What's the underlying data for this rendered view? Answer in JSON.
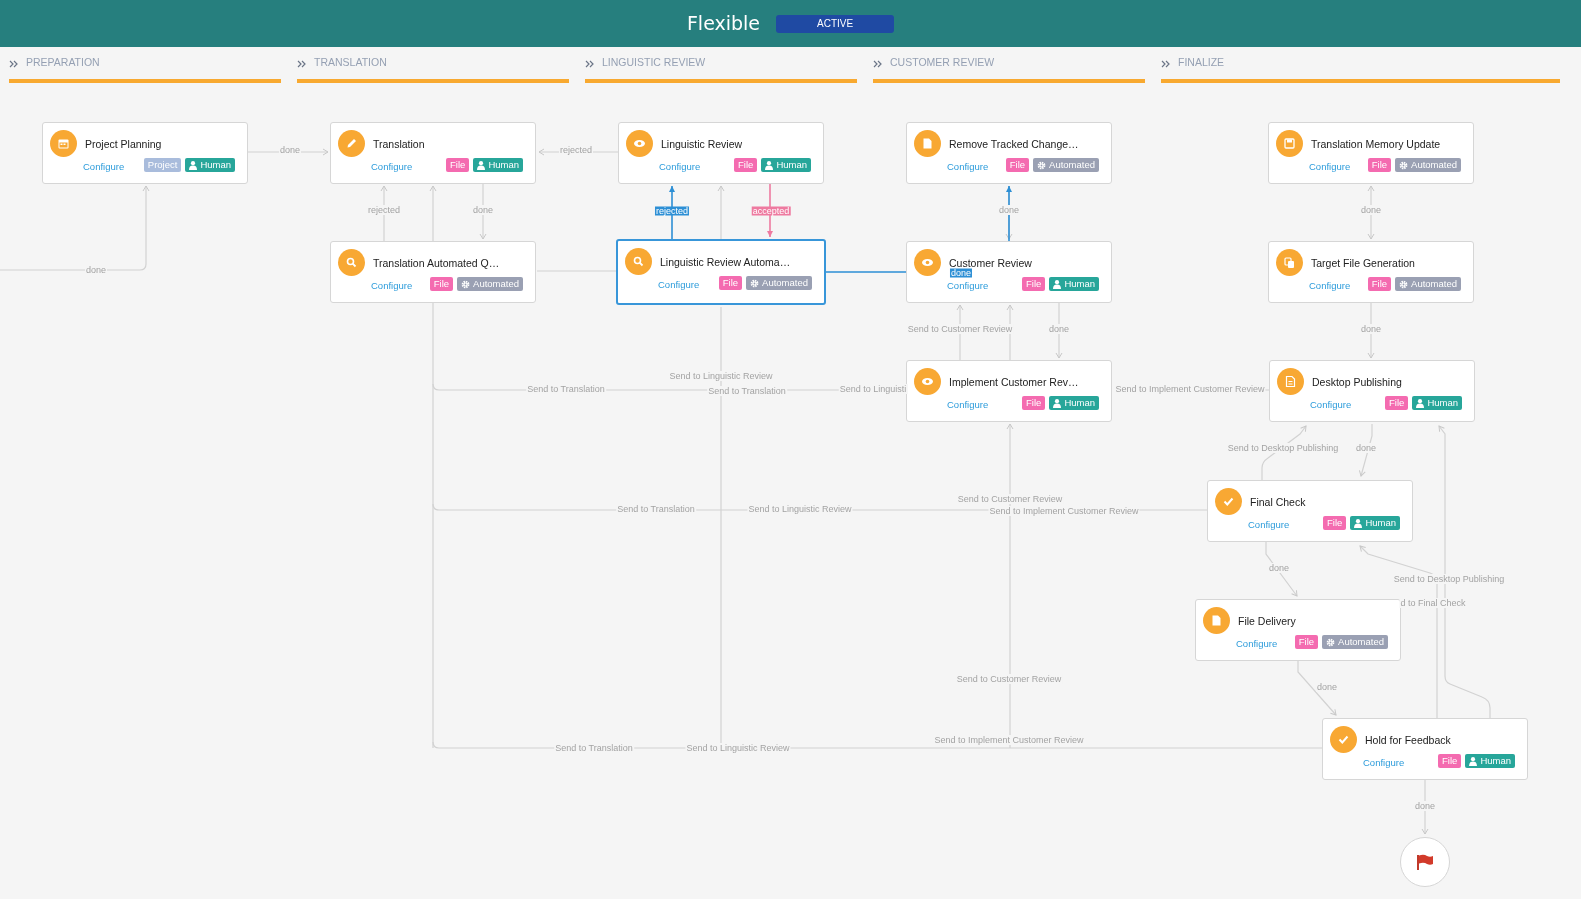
{
  "header": {
    "title": "Flexible",
    "status": "ACTIVE"
  },
  "stages": [
    {
      "label": "PREPARATION"
    },
    {
      "label": "TRANSLATION"
    },
    {
      "label": "LINGUISTIC REVIEW"
    },
    {
      "label": "CUSTOMER REVIEW"
    },
    {
      "label": "FINALIZE"
    }
  ],
  "nodes": [
    {
      "title": "Project Planning",
      "link": "Configure",
      "selected": false,
      "tags": [
        {
          "text": "Project",
          "kind": "project"
        },
        {
          "text": "Human",
          "kind": "human"
        }
      ]
    },
    {
      "title": "Translation",
      "link": "Configure",
      "selected": false,
      "tags": [
        {
          "text": "File",
          "kind": "file"
        },
        {
          "text": "Human",
          "kind": "human"
        }
      ]
    },
    {
      "title": "Linguistic Review",
      "link": "Configure",
      "selected": false,
      "tags": [
        {
          "text": "File",
          "kind": "file"
        },
        {
          "text": "Human",
          "kind": "human"
        }
      ]
    },
    {
      "title": "Remove Tracked Change…",
      "link": "Configure",
      "selected": false,
      "tags": [
        {
          "text": "File",
          "kind": "file"
        },
        {
          "text": "Automated",
          "kind": "automated"
        }
      ]
    },
    {
      "title": "Translation Memory Update",
      "link": "Configure",
      "selected": false,
      "tags": [
        {
          "text": "File",
          "kind": "file"
        },
        {
          "text": "Automated",
          "kind": "automated"
        }
      ]
    },
    {
      "title": "Translation Automated Q…",
      "link": "Configure",
      "selected": false,
      "tags": [
        {
          "text": "File",
          "kind": "file"
        },
        {
          "text": "Automated",
          "kind": "automated"
        }
      ]
    },
    {
      "title": "Linguistic Review Automa…",
      "link": "Configure",
      "selected": true,
      "tags": [
        {
          "text": "File",
          "kind": "file"
        },
        {
          "text": "Automated",
          "kind": "automated"
        }
      ]
    },
    {
      "title": "Customer Review",
      "link": "Configure",
      "selected": false,
      "tags": [
        {
          "text": "File",
          "kind": "file"
        },
        {
          "text": "Human",
          "kind": "human"
        }
      ]
    },
    {
      "title": "Target File Generation",
      "link": "Configure",
      "selected": false,
      "tags": [
        {
          "text": "File",
          "kind": "file"
        },
        {
          "text": "Automated",
          "kind": "automated"
        }
      ]
    },
    {
      "title": "Implement Customer Rev…",
      "link": "Configure",
      "selected": false,
      "tags": [
        {
          "text": "File",
          "kind": "file"
        },
        {
          "text": "Human",
          "kind": "human"
        }
      ]
    },
    {
      "title": "Desktop Publishing",
      "link": "Configure",
      "selected": false,
      "tags": [
        {
          "text": "File",
          "kind": "file"
        },
        {
          "text": "Human",
          "kind": "human"
        }
      ]
    },
    {
      "title": "Final Check",
      "link": "Configure",
      "selected": false,
      "tags": [
        {
          "text": "File",
          "kind": "file"
        },
        {
          "text": "Human",
          "kind": "human"
        }
      ]
    },
    {
      "title": "File Delivery",
      "link": "Configure",
      "selected": false,
      "tags": [
        {
          "text": "File",
          "kind": "file"
        },
        {
          "text": "Automated",
          "kind": "automated"
        }
      ]
    },
    {
      "title": "Hold for Feedback",
      "link": "Configure",
      "selected": false,
      "tags": [
        {
          "text": "File",
          "kind": "file"
        },
        {
          "text": "Human",
          "kind": "human"
        }
      ]
    }
  ],
  "edges": [
    {
      "label": "done"
    },
    {
      "label": "rejected"
    },
    {
      "label": "rejected"
    },
    {
      "label": "done"
    },
    {
      "label": "done"
    },
    {
      "label": "rejected",
      "color": "#2d8fd5"
    },
    {
      "label": "accepted",
      "color": "#ee7aa0"
    },
    {
      "label": "done",
      "color": "#2d8fd5"
    },
    {
      "label": "done"
    },
    {
      "label": "Send to Customer Review"
    },
    {
      "label": "done"
    },
    {
      "label": "done"
    },
    {
      "label": "done"
    },
    {
      "label": "Send to Translation"
    },
    {
      "label": "Send to Linguistic Review"
    },
    {
      "label": "Send to Translation"
    },
    {
      "label": "Send to Linguisti"
    },
    {
      "label": "Send to Implement Customer Review"
    },
    {
      "label": "Send to Translation"
    },
    {
      "label": "Send to Linguistic Review"
    },
    {
      "label": "Send to Customer Review"
    },
    {
      "label": "Send to Implement Customer Review"
    },
    {
      "label": "Send to Desktop Publishing"
    },
    {
      "label": "done"
    },
    {
      "label": "done"
    },
    {
      "label": "Send to Desktop Publishing"
    },
    {
      "label": "d to Final Check"
    },
    {
      "label": "done"
    },
    {
      "label": "Send to Customer Review"
    },
    {
      "label": "Send to Translation"
    },
    {
      "label": "Send to Linguistic Review"
    },
    {
      "label": "Send to Implement Customer Review"
    },
    {
      "label": "done"
    }
  ]
}
